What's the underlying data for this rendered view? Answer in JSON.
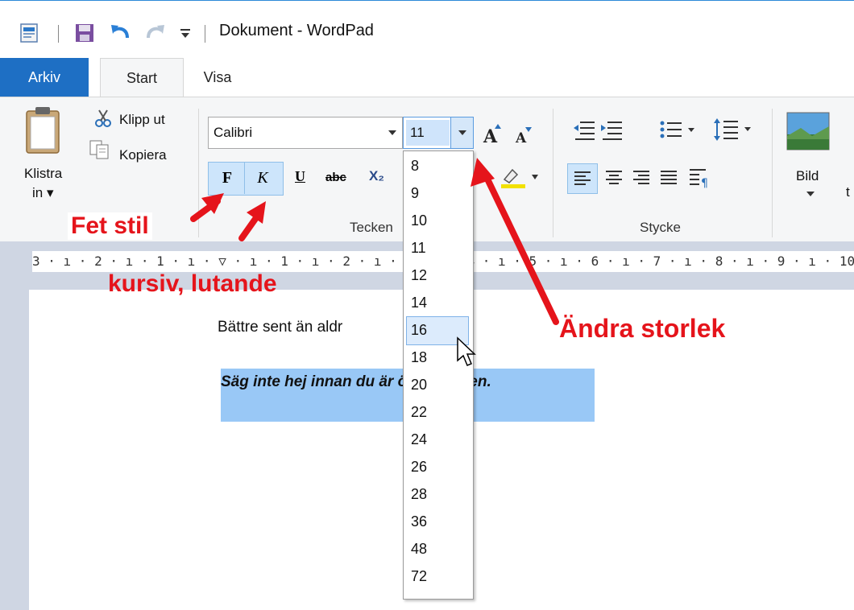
{
  "window": {
    "title": "Dokument - WordPad"
  },
  "tabs": {
    "arkiv": "Arkiv",
    "start": "Start",
    "visa": "Visa"
  },
  "clipboard": {
    "paste_label_1": "Klistra",
    "paste_label_2": "in ▾",
    "cut": "Klipp ut",
    "copy": "Kopiera"
  },
  "font": {
    "name": "Calibri",
    "size": "11",
    "bold": "F",
    "italic": "K",
    "underline": "U",
    "strike": "abc",
    "subscript": "X₂",
    "group_label": "Tecken"
  },
  "paragraph": {
    "group_label": "Stycke"
  },
  "insert": {
    "picture_label": "Bild"
  },
  "ruler": {
    "text": "3 · ı · 2 · ı · 1 · ı · ▽ · ı · 1 · ı · 2 · ı · 3 · ı · 4 · ı · 5 · ı · 6 · ı · 7 · ı · 8 · ı · 9 · ı · 10 ·"
  },
  "document": {
    "line1": "Bättre sent än aldr",
    "line2": "Säg inte hej innan du är över bäcken."
  },
  "size_dropdown": {
    "options": [
      "8",
      "9",
      "10",
      "11",
      "12",
      "14",
      "16",
      "18",
      "20",
      "22",
      "24",
      "26",
      "28",
      "36",
      "48",
      "72"
    ],
    "hovered": "16"
  },
  "annotations": {
    "bold": "Fet stil",
    "italic": "kursiv, lutande",
    "size": "Ändra storlek"
  },
  "colors": {
    "accent": "#1e6fc4",
    "annotation": "#e5141b",
    "selection": "#99c8f6"
  }
}
